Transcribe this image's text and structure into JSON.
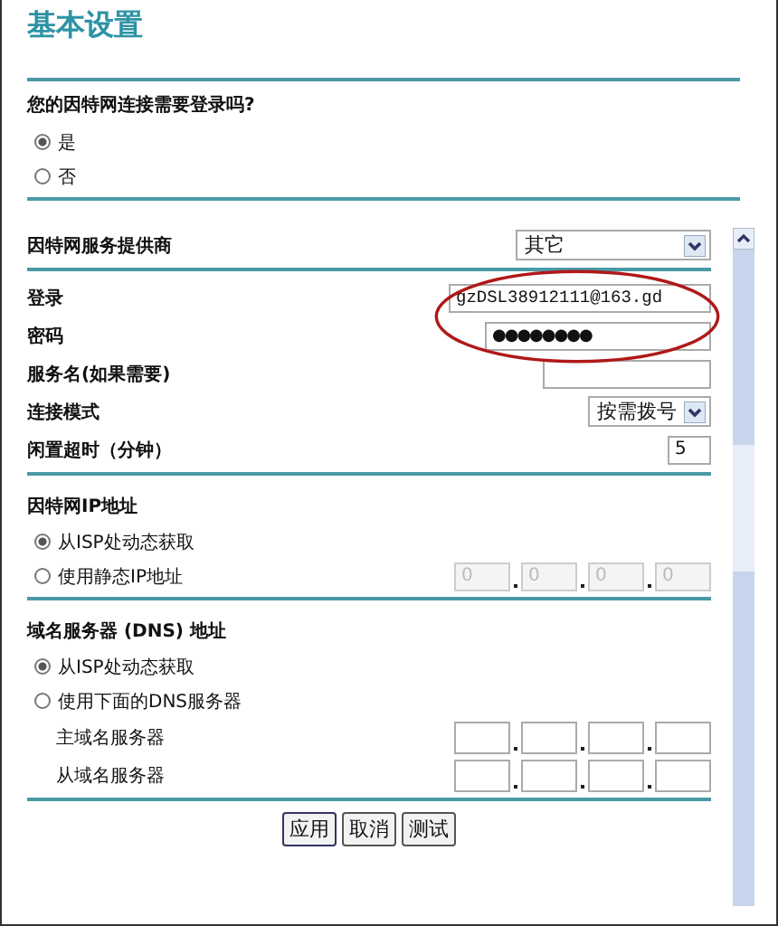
{
  "title": "基本设置",
  "login_question": {
    "text": "您的因特网连接需要登录吗?",
    "options": [
      {
        "label": "是",
        "selected": true
      },
      {
        "label": "否",
        "selected": false
      }
    ]
  },
  "isp": {
    "label": "因特网服务提供商",
    "value": "其它"
  },
  "fields": [
    {
      "kind": "text",
      "label": "登录",
      "value": "gzDSL38912111@163.gd"
    },
    {
      "kind": "password",
      "label": "密码",
      "value": "●●●●●●●●"
    },
    {
      "kind": "empty",
      "label": "服务名(如果需要)"
    },
    {
      "kind": "select",
      "label": "连接模式",
      "value": "按需拨号"
    },
    {
      "kind": "small",
      "label": "闲置超时（分钟）",
      "value": "5"
    }
  ],
  "ip": {
    "heading": "因特网IP地址",
    "options": [
      {
        "label": "从ISP处动态获取",
        "selected": true
      },
      {
        "label": "使用静态IP地址",
        "selected": false
      }
    ],
    "octets": [
      "0",
      "0",
      "0",
      "0"
    ],
    "disabled": true
  },
  "dns": {
    "heading": "域名服务器 (DNS) 地址",
    "options": [
      {
        "label": "从ISP处动态获取",
        "selected": true
      },
      {
        "label": "使用下面的DNS服务器",
        "selected": false
      }
    ],
    "servers": [
      {
        "label": "主域名服务器"
      },
      {
        "label": "从域名服务器"
      }
    ]
  },
  "buttons": [
    "应用",
    "取消",
    "测试"
  ]
}
